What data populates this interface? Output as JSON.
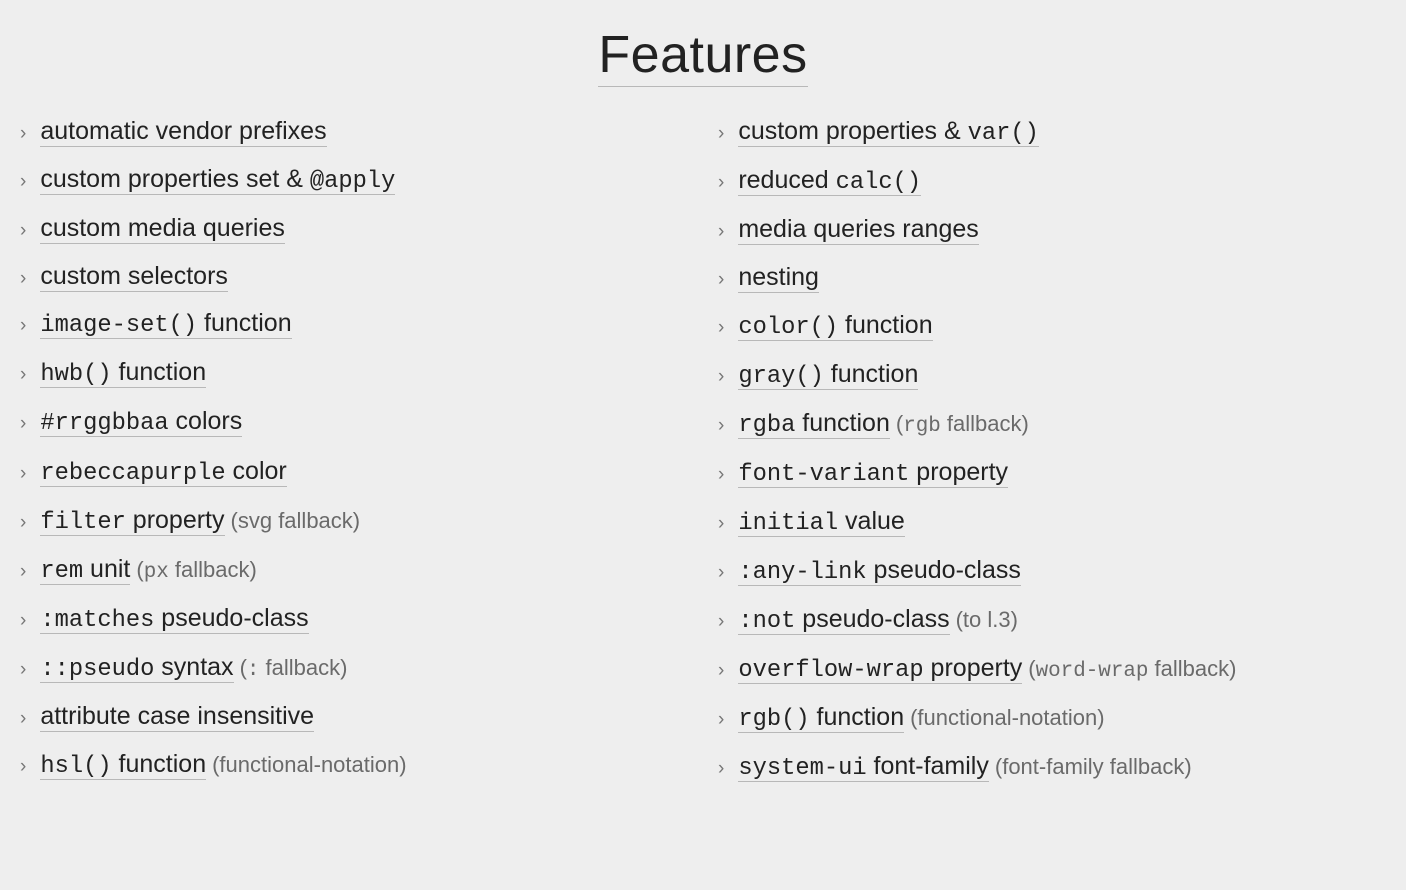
{
  "title": "Features",
  "bullet": "›",
  "left": [
    {
      "segs": [
        {
          "t": "automatic vendor prefixes"
        }
      ]
    },
    {
      "segs": [
        {
          "t": "custom properties set & "
        },
        {
          "t": "@apply",
          "mono": true
        }
      ]
    },
    {
      "segs": [
        {
          "t": "custom media queries"
        }
      ]
    },
    {
      "segs": [
        {
          "t": "custom selectors"
        }
      ]
    },
    {
      "segs": [
        {
          "t": "image-set()",
          "mono": true
        },
        {
          "t": " function"
        }
      ]
    },
    {
      "segs": [
        {
          "t": "hwb()",
          "mono": true
        },
        {
          "t": " function"
        }
      ]
    },
    {
      "segs": [
        {
          "t": "#rrggbbaa",
          "mono": true
        },
        {
          "t": " colors"
        }
      ]
    },
    {
      "segs": [
        {
          "t": "rebeccapurple",
          "mono": true
        },
        {
          "t": " color"
        }
      ]
    },
    {
      "segs": [
        {
          "t": "filter",
          "mono": true
        },
        {
          "t": " property"
        }
      ],
      "note": [
        {
          "t": "(svg fallback)"
        }
      ]
    },
    {
      "segs": [
        {
          "t": "rem",
          "mono": true
        },
        {
          "t": " unit"
        }
      ],
      "note": [
        {
          "t": "("
        },
        {
          "t": "px",
          "mono": true
        },
        {
          "t": " fallback)"
        }
      ]
    },
    {
      "segs": [
        {
          "t": ":matches",
          "mono": true
        },
        {
          "t": " pseudo-class"
        }
      ]
    },
    {
      "segs": [
        {
          "t": "::pseudo",
          "mono": true
        },
        {
          "t": " syntax"
        }
      ],
      "note": [
        {
          "t": "("
        },
        {
          "t": ":",
          "mono": true
        },
        {
          "t": " fallback)"
        }
      ]
    },
    {
      "segs": [
        {
          "t": "attribute case insensitive"
        }
      ]
    },
    {
      "segs": [
        {
          "t": "hsl()",
          "mono": true
        },
        {
          "t": " function"
        }
      ],
      "note": [
        {
          "t": "(functional-notation)"
        }
      ]
    }
  ],
  "right": [
    {
      "segs": [
        {
          "t": "custom properties & "
        },
        {
          "t": "var()",
          "mono": true
        }
      ]
    },
    {
      "segs": [
        {
          "t": "reduced "
        },
        {
          "t": "calc()",
          "mono": true
        }
      ]
    },
    {
      "segs": [
        {
          "t": "media queries ranges"
        }
      ]
    },
    {
      "segs": [
        {
          "t": "nesting"
        }
      ]
    },
    {
      "segs": [
        {
          "t": "color()",
          "mono": true
        },
        {
          "t": " function"
        }
      ]
    },
    {
      "segs": [
        {
          "t": "gray()",
          "mono": true
        },
        {
          "t": " function"
        }
      ]
    },
    {
      "segs": [
        {
          "t": "rgba",
          "mono": true
        },
        {
          "t": " function"
        }
      ],
      "note": [
        {
          "t": "("
        },
        {
          "t": "rgb",
          "mono": true
        },
        {
          "t": " fallback)"
        }
      ]
    },
    {
      "segs": [
        {
          "t": "font-variant",
          "mono": true
        },
        {
          "t": " property"
        }
      ]
    },
    {
      "segs": [
        {
          "t": "initial",
          "mono": true
        },
        {
          "t": " value"
        }
      ]
    },
    {
      "segs": [
        {
          "t": ":any-link",
          "mono": true
        },
        {
          "t": " pseudo-class"
        }
      ]
    },
    {
      "segs": [
        {
          "t": ":not",
          "mono": true
        },
        {
          "t": " pseudo-class"
        }
      ],
      "note": [
        {
          "t": "(to l.3)"
        }
      ]
    },
    {
      "segs": [
        {
          "t": "overflow-wrap",
          "mono": true
        },
        {
          "t": " property"
        }
      ],
      "note": [
        {
          "t": "("
        },
        {
          "t": "word-wrap",
          "mono": true
        },
        {
          "t": " fallback)"
        }
      ]
    },
    {
      "segs": [
        {
          "t": "rgb()",
          "mono": true
        },
        {
          "t": " function"
        }
      ],
      "note": [
        {
          "t": "(functional-notation)"
        }
      ]
    },
    {
      "segs": [
        {
          "t": "system-ui",
          "mono": true
        },
        {
          "t": " font-family"
        }
      ],
      "note": [
        {
          "t": "(font-family fallback)"
        }
      ]
    }
  ]
}
